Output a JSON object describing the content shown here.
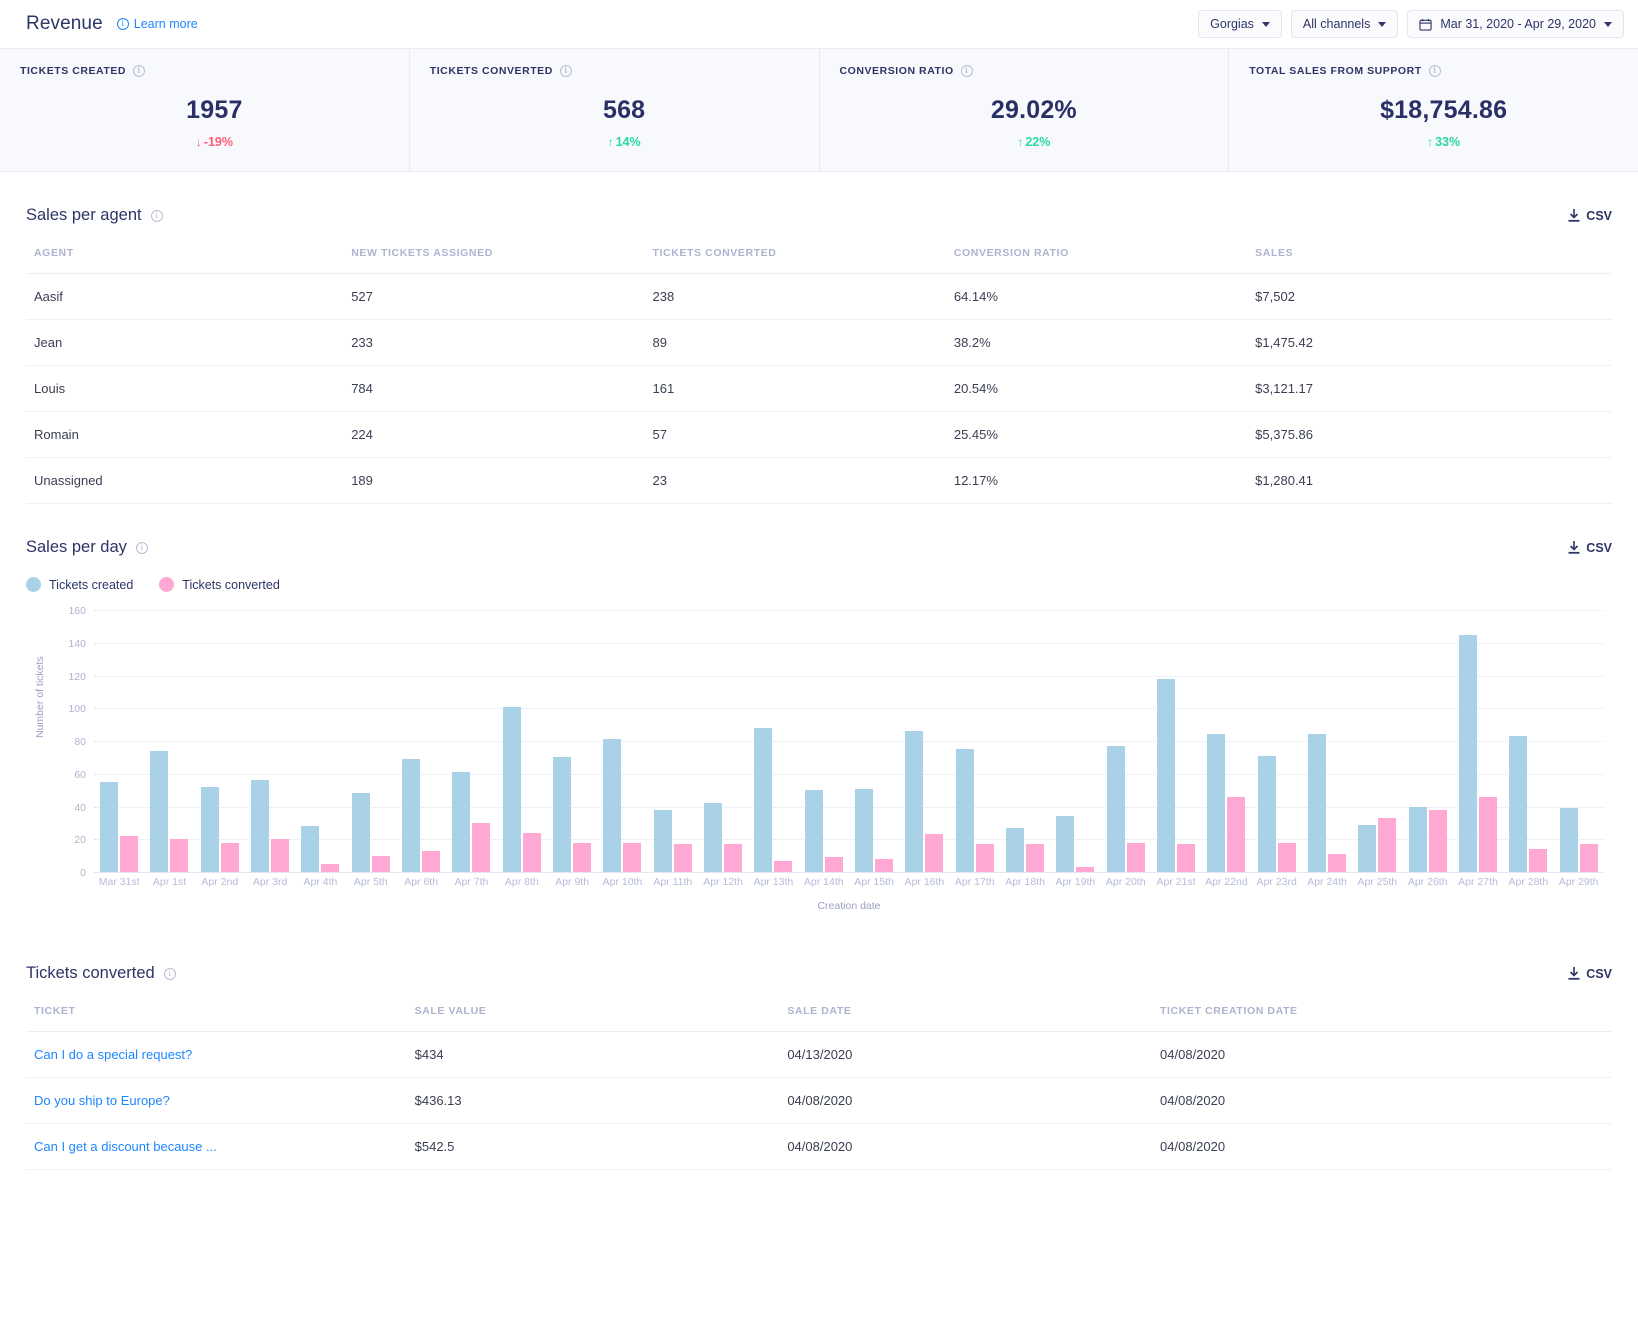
{
  "header": {
    "title": "Revenue",
    "learn_more": "Learn more",
    "info_icon": "info-icon",
    "controls": [
      {
        "label": "Gorgias",
        "icon": "chevron-down-icon",
        "name": "account-selector"
      },
      {
        "label": "All channels",
        "icon": "chevron-down-icon",
        "name": "channel-selector"
      },
      {
        "label": "Mar 31, 2020 - Apr 29, 2020",
        "icon": "calendar-icon",
        "name": "date-range-selector"
      }
    ]
  },
  "kpis": [
    {
      "label": "TICKETS CREATED",
      "value": "1957",
      "delta": "-19%",
      "direction": "down",
      "arrow": "↓"
    },
    {
      "label": "TICKETS CONVERTED",
      "value": "568",
      "delta": "14%",
      "direction": "up",
      "arrow": "↑"
    },
    {
      "label": "CONVERSION RATIO",
      "value": "29.02%",
      "delta": "22%",
      "direction": "up",
      "arrow": "↑"
    },
    {
      "label": "TOTAL SALES FROM SUPPORT",
      "value": "$18,754.86",
      "delta": "33%",
      "direction": "up",
      "arrow": "↑"
    }
  ],
  "sales_per_agent": {
    "title": "Sales per agent",
    "csv_label": "CSV",
    "columns": [
      "AGENT",
      "NEW TICKETS ASSIGNED",
      "TICKETS CONVERTED",
      "CONVERSION RATIO",
      "SALES"
    ],
    "rows": [
      [
        "Aasif",
        "527",
        "238",
        "64.14%",
        "$7,502"
      ],
      [
        "Jean",
        "233",
        "89",
        "38.2%",
        "$1,475.42"
      ],
      [
        "Louis",
        "784",
        "161",
        "20.54%",
        "$3,121.17"
      ],
      [
        "Romain",
        "224",
        "57",
        "25.45%",
        "$5,375.86"
      ],
      [
        "Unassigned",
        "189",
        "23",
        "12.17%",
        "$1,280.41"
      ]
    ]
  },
  "sales_per_day": {
    "title": "Sales per day",
    "csv_label": "CSV",
    "legend": [
      {
        "label": "Tickets created",
        "color": "#a9d2e8"
      },
      {
        "label": "Tickets converted",
        "color": "#ffa8d4"
      }
    ]
  },
  "chart_data": {
    "type": "bar",
    "title": "Sales per day",
    "xlabel": "Creation date",
    "ylabel": "Number of tickets",
    "ylim": [
      0,
      160
    ],
    "yticks": [
      0,
      20,
      40,
      60,
      80,
      100,
      120,
      140,
      160
    ],
    "grid": true,
    "legend_position": "top-left",
    "categories": [
      "Mar 31st",
      "Apr 1st",
      "Apr 2nd",
      "Apr 3rd",
      "Apr 4th",
      "Apr 5th",
      "Apr 6th",
      "Apr 7th",
      "Apr 8th",
      "Apr 9th",
      "Apr 10th",
      "Apr 11th",
      "Apr 12th",
      "Apr 13th",
      "Apr 14th",
      "Apr 15th",
      "Apr 16th",
      "Apr 17th",
      "Apr 18th",
      "Apr 19th",
      "Apr 20th",
      "Apr 21st",
      "Apr 22nd",
      "Apr 23rd",
      "Apr 24th",
      "Apr 25th",
      "Apr 26th",
      "Apr 27th",
      "Apr 28th",
      "Apr 29th"
    ],
    "series": [
      {
        "name": "Tickets created",
        "color": "#a9d2e8",
        "values": [
          55,
          74,
          52,
          56,
          28,
          48,
          69,
          61,
          101,
          70,
          81,
          38,
          42,
          88,
          50,
          51,
          86,
          75,
          27,
          34,
          77,
          118,
          84,
          71,
          84,
          29,
          40,
          145,
          83,
          39
        ]
      },
      {
        "name": "Tickets converted",
        "color": "#ffa8d4",
        "values": [
          22,
          20,
          18,
          20,
          5,
          10,
          13,
          30,
          24,
          18,
          18,
          17,
          17,
          7,
          9,
          8,
          23,
          17,
          17,
          3,
          18,
          17,
          46,
          18,
          11,
          33,
          38,
          46,
          14,
          17
        ]
      }
    ]
  },
  "tickets_converted": {
    "title": "Tickets converted",
    "csv_label": "CSV",
    "columns": [
      "TICKET",
      "SALE VALUE",
      "SALE DATE",
      "TICKET CREATION DATE"
    ],
    "rows": [
      [
        "Can I do a special request?",
        "$434",
        "04/13/2020",
        "04/08/2020"
      ],
      [
        "Do you ship to Europe?",
        "$436.13",
        "04/08/2020",
        "04/08/2020"
      ],
      [
        "Can I get a discount because ...",
        "$542.5",
        "04/08/2020",
        "04/08/2020"
      ]
    ]
  }
}
